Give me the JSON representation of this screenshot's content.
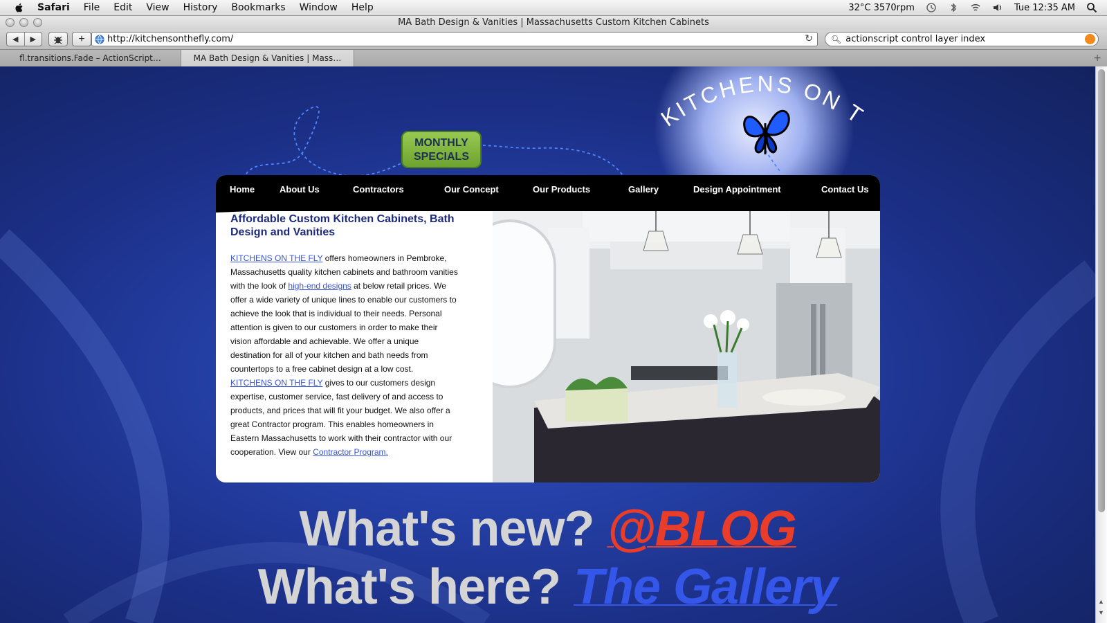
{
  "menubar": {
    "app": "Safari",
    "items": [
      "File",
      "Edit",
      "View",
      "History",
      "Bookmarks",
      "Window",
      "Help"
    ],
    "status": "32°C 3570rpm",
    "clock": "Tue 12:35 AM"
  },
  "window": {
    "title": "MA Bath Design & Vanities | Massachusetts Custom Kitchen Cabinets"
  },
  "toolbar": {
    "url": "http://kitchensonthefly.com/",
    "search": "actionscript control layer index"
  },
  "tabs": [
    {
      "label": "fl.transitions.Fade – ActionScript…",
      "active": false
    },
    {
      "label": "MA Bath Design & Vanities | Mass…",
      "active": true
    }
  ],
  "site": {
    "logo_text": "KITCHENS ON THE FLY",
    "specials": {
      "line1": "MONTHLY",
      "line2": "SPECIALS"
    },
    "nav": [
      "Home",
      "About Us",
      "Contractors",
      "Our Concept",
      "Our Products",
      "Gallery",
      "Design Appointment",
      "Contact Us"
    ],
    "heading": "Affordable Custom Kitchen Cabinets, Bath Design and Vanities",
    "p1": {
      "link1": "KITCHENS ON THE FLY",
      "text1": " offers homeowners in Pembroke, Massachusetts quality kitchen cabinets and bathroom vanities with the look of ",
      "link2": "high-end designs",
      "text2": " at below retail prices. We offer a wide variety of unique lines to enable our customers to achieve the look that is individual to their needs. Personal attention is given to our customers in order to make their vision affordable and achievable. We offer a unique destination for all of your kitchen and bath needs from countertops to a free cabinet design at a low cost."
    },
    "p2": {
      "link1": "KITCHENS ON THE FLY",
      "text1": " gives to our customers design expertise, customer service, fast delivery of and access to products, and prices that will fit your budget. We also offer a great Contractor program. This enables homeowners in Eastern Massachusetts to work with their contractor with our cooperation. View our ",
      "link2": "Contractor Program."
    },
    "blog_line": {
      "question": "What's new? ",
      "link": "@BLOG"
    },
    "gallery_line": {
      "question": "What's here? ",
      "link": "The Gallery"
    }
  },
  "colors": {
    "page_bg": "#1b2f86",
    "nav_bg": "#000000",
    "heading": "#1d2b7a",
    "link": "#3a54d8",
    "blog": "#e93d2a",
    "gallery": "#3457ea",
    "specials": "#7eb33b"
  }
}
